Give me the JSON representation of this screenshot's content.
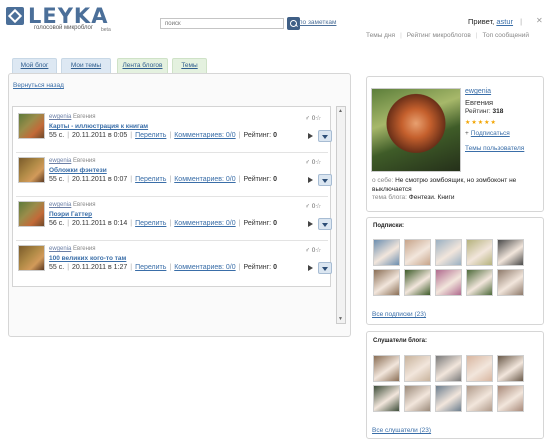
{
  "header": {
    "logo_text": "LEYKA",
    "logo_sub": "голосовой микроблог",
    "logo_beta": "beta",
    "search_placeholder": "поиск",
    "search_scope": "по заметкам",
    "greeting": "Привет,",
    "username": "astur",
    "greeting_sep": "|",
    "nav": [
      "Темы дня",
      "Рейтинг микроблогов",
      "Топ сообщений"
    ]
  },
  "tabs": [
    "Мой блог",
    "Мои темы",
    "Лента блогов",
    "Темы"
  ],
  "main": {
    "back_link": "Вернуться назад",
    "posts": [
      {
        "login": "ewgenia",
        "name": "Евгения",
        "title": "Карты - иллюстрация к книгам",
        "duration": "55 с.",
        "date": "20.11.2011 в 0:05",
        "repost": "Перелить",
        "comments": "Комментариев: 0/0",
        "rating_label": "Рейтинг:",
        "rating": "0",
        "fav": "0"
      },
      {
        "login": "ewgenia",
        "name": "Евгения",
        "title": "Обложки фэнтези",
        "duration": "55 с.",
        "date": "20.11.2011 в 0:07",
        "repost": "Перелить",
        "comments": "Комментариев: 0/0",
        "rating_label": "Рейтинг:",
        "rating": "0",
        "fav": "0"
      },
      {
        "login": "ewgenia",
        "name": "Евгения",
        "title": "Поэри Гаттер",
        "duration": "56 с.",
        "date": "20.11.2011 в 0:14",
        "repost": "Перелить",
        "comments": "Комментариев: 0/0",
        "rating_label": "Рейтинг:",
        "rating": "0",
        "fav": "0"
      },
      {
        "login": "ewgenia",
        "name": "Евгения",
        "title": "100 великих кого-то там",
        "duration": "55 с.",
        "date": "20.11.2011 в 1:27",
        "repost": "Перелить",
        "comments": "Комментариев: 0/0",
        "rating_label": "Рейтинг:",
        "rating": "0",
        "fav": "0"
      }
    ]
  },
  "profile": {
    "login": "ewgenia",
    "name": "Евгения",
    "rating_label": "Рейтинг:",
    "rating": "318",
    "subscribe": "Подписаться",
    "topics_link": "Темы пользователя",
    "about_label": "о себе:",
    "about_text": "Не смотрю зомбоящик, но зомбоконт не выключается",
    "topic_label": "тема блога:",
    "topic_text": "Фентези. Книги"
  },
  "subscriptions": {
    "title": "Подписки:",
    "link": "Все подписки (23)",
    "avatar_colors": [
      "#6d8fb0",
      "#c7a48a",
      "#9ab0c2",
      "#b5b27d",
      "#4a4a4a",
      "#8a6e55",
      "#3e5c2a",
      "#b06a8e",
      "#4d6a3a",
      "#8e7a6b"
    ]
  },
  "listeners": {
    "title": "Слушатели блога:",
    "link": "Все слушатели (23)",
    "avatar_colors": [
      "#8a6e55",
      "#c8b39c",
      "#7a7a7a",
      "#d8b6a0",
      "#6a5a4a",
      "#3e4e3a",
      "#9b8a7a",
      "#6c7e8e",
      "#b09a8a",
      "#a88a7a"
    ]
  }
}
